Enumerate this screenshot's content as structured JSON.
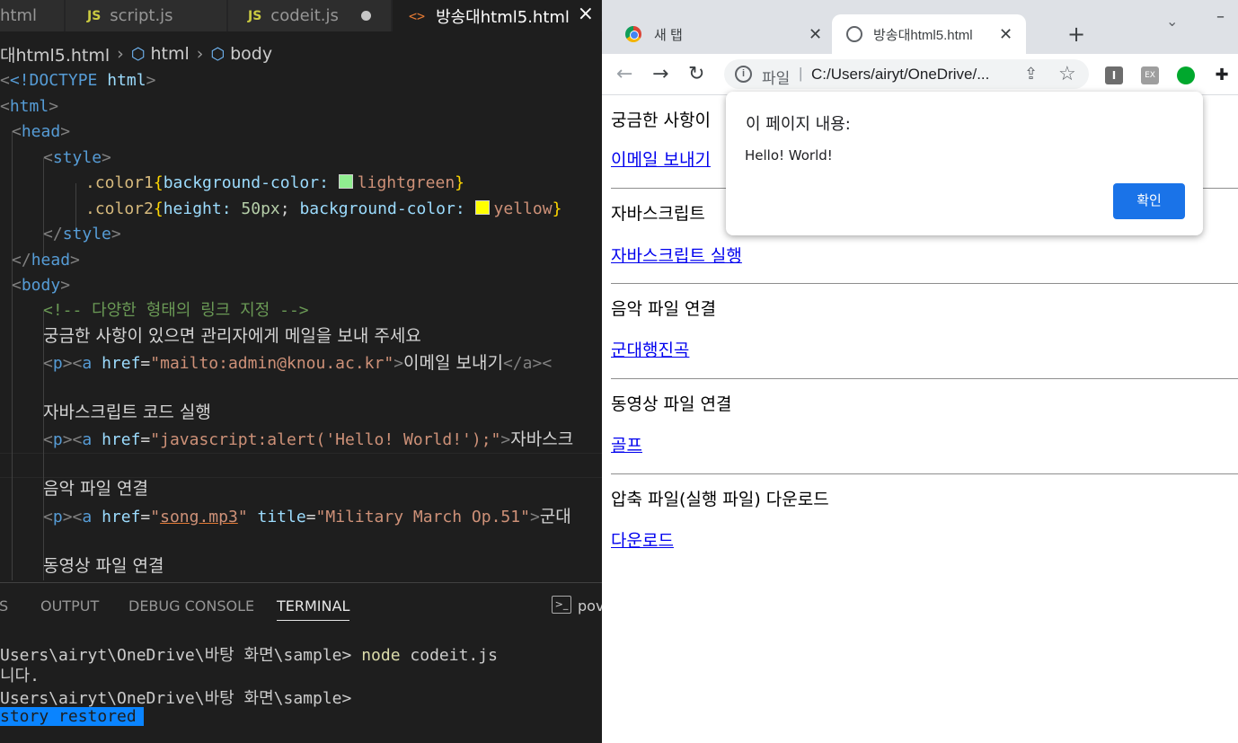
{
  "editor": {
    "tabs": [
      {
        "label": "html"
      },
      {
        "label": "script.js",
        "icon": "JS"
      },
      {
        "label": "codeit.js",
        "icon": "JS"
      },
      {
        "label": "방송대html5.html",
        "icon": "<>"
      }
    ],
    "breadcrumb": {
      "file": "대html5.html",
      "node1": "html",
      "node2": "body"
    },
    "code": {
      "doctype": "<!DOCTYPE",
      "doctype_kw": "html",
      "html_tag": "html",
      "head_tag": "head",
      "style_tag": "style",
      "color1_sel": ".color1",
      "color1_prop": "background-color:",
      "color1_val": "lightgreen",
      "color2_sel": ".color2",
      "color2_prop1": "height:",
      "color2_num": "50px",
      "color2_prop2": "background-color:",
      "color2_val": "yellow",
      "body_tag": "body",
      "comment": "<!-- 다양한 형태의 링크 지정 -->",
      "text1": "궁금한 사항이 있으면 관리자에게 메일을 보내 주세요",
      "href1": "\"mailto:admin@knou.ac.kr\"",
      "link1_text": "이메일 보내기",
      "link1_close": "</a><",
      "text2": "자바스크립트 코드 실행",
      "href2": "\"javascript:alert('Hello! World!');\"",
      "link2_text": "자바스크",
      "text3": "음악 파일 연결",
      "href3": "song.mp3",
      "title_attr": "\"Military March Op.51\"",
      "link3_text": "군대",
      "text4": "동영상 파일 연결"
    },
    "swatch_colors": {
      "lightgreen": "#90ee90",
      "yellow": "#ffff00"
    }
  },
  "panel": {
    "tabs": [
      "S",
      "OUTPUT",
      "DEBUG CONSOLE",
      "TERMINAL"
    ],
    "shell_label": "pov",
    "terminal": {
      "line1_prompt": "Users\\airyt\\OneDrive\\바탕 화면\\sample>",
      "line1_cmd": "node",
      "line1_arg": "codeit.js",
      "line2": "니다.",
      "line3_prompt": "Users\\airyt\\OneDrive\\바탕 화면\\sample>",
      "line4": "story restored"
    }
  },
  "browser": {
    "tabs": [
      {
        "label": "새 탭"
      },
      {
        "label": "방송대html5.html"
      }
    ],
    "address": {
      "scheme": "파일",
      "url": "C:/Users/airyt/OneDrive/..."
    },
    "extensions": [
      "I",
      "EX",
      "evernote",
      "puzzle"
    ],
    "page": {
      "s1_text": "궁금한 사항이",
      "s1_link": "이메일 보내기",
      "s2_text": "자바스크립트",
      "s2_link": "자바스크립트 실행",
      "s3_text": "음악 파일 연결",
      "s3_link": "군대행진곡",
      "s4_text": "동영상 파일 연결",
      "s4_link": "골프",
      "s5_text": "압축 파일(실행 파일) 다운로드",
      "s5_link": "다운로드"
    },
    "dialog": {
      "title": "이 페이지 내용:",
      "message": "Hello! World!",
      "ok_label": "확인"
    }
  }
}
